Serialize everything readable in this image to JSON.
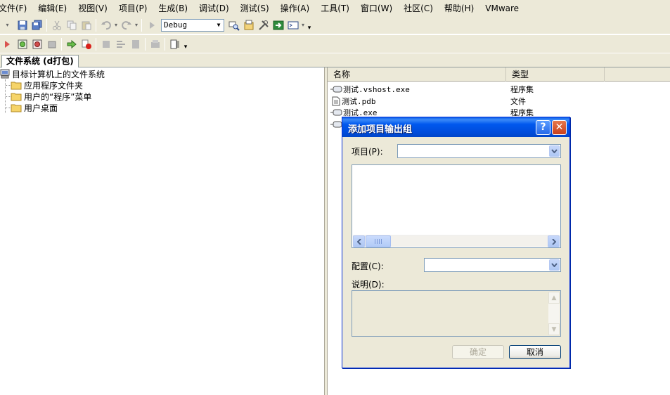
{
  "menu": [
    "文件(F)",
    "编辑(E)",
    "视图(V)",
    "项目(P)",
    "生成(B)",
    "调试(D)",
    "测试(S)",
    "操作(A)",
    "工具(T)",
    "窗口(W)",
    "社区(C)",
    "帮助(H)",
    "VMware"
  ],
  "toolbar": {
    "config_combo": "Debug"
  },
  "tab": {
    "label": "文件系统 (d打包)"
  },
  "tree": {
    "root": "目标计算机上的文件系统",
    "children": [
      "应用程序文件夹",
      "用户的“程序”菜单",
      "用户桌面"
    ]
  },
  "filelist": {
    "headers": {
      "name": "名称",
      "type": "类型"
    },
    "rows": [
      {
        "name": "测试.vshost.exe",
        "type": "程序集"
      },
      {
        "name": "测试.pdb",
        "type": "文件"
      },
      {
        "name": "测试.exe",
        "type": "程序集"
      }
    ]
  },
  "dialog": {
    "title": "添加项目输出组",
    "help": "?",
    "close": "✕",
    "project_label": "项目(P):",
    "project_value": "",
    "config_label": "配置(C):",
    "config_value": "",
    "desc_label": "说明(D):",
    "ok": "确定",
    "cancel": "取消"
  }
}
